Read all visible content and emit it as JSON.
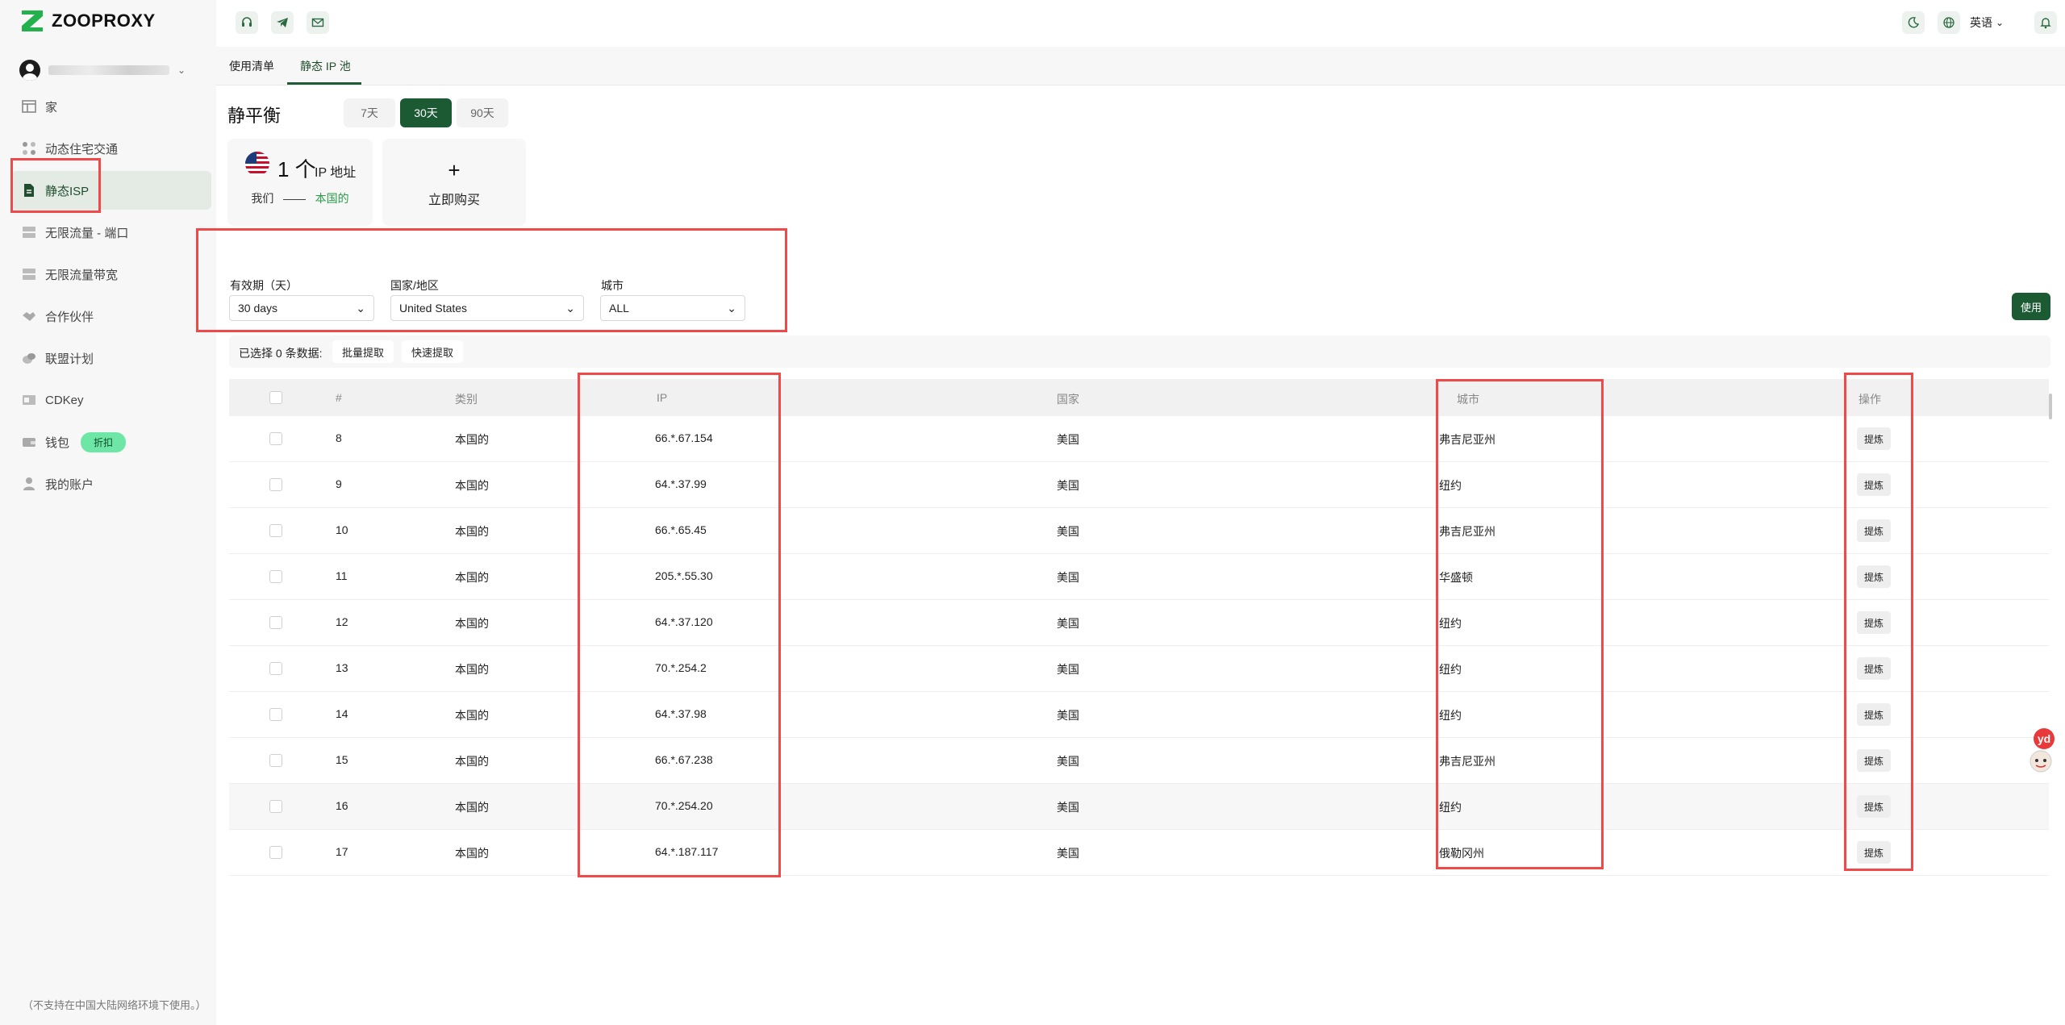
{
  "brand": {
    "name": "ZOOPROXY",
    "accent": "#1c5a34",
    "logo_color": "#22b14c"
  },
  "sidebar": {
    "items": [
      {
        "label": "家",
        "icon": "layout-icon"
      },
      {
        "label": "动态住宅交通",
        "icon": "nodes-icon"
      },
      {
        "label": "静态ISP",
        "icon": "document-icon"
      },
      {
        "label": "无限流量 - 端口",
        "icon": "server-icon"
      },
      {
        "label": "无限流量带宽",
        "icon": "server-icon"
      },
      {
        "label": "合作伙伴",
        "icon": "handshake-icon"
      },
      {
        "label": "联盟计划",
        "icon": "coins-icon"
      },
      {
        "label": "CDKey",
        "icon": "card-icon"
      },
      {
        "label": "钱包",
        "icon": "wallet-icon",
        "badge": "折扣"
      },
      {
        "label": "我的账户",
        "icon": "user-icon"
      }
    ],
    "footer": "（不支持在中国大陆网络环境下使用。）"
  },
  "topbar": {
    "language": "英语"
  },
  "tabs": [
    "使用清单",
    "静态 IP 池"
  ],
  "balance": {
    "title": "静平衡",
    "periods": [
      "7天",
      "30天",
      "90天"
    ],
    "active_period": "30天",
    "count": "1 个",
    "unit": "IP 地址",
    "region": "我们",
    "dash": "——",
    "type": "本国的",
    "buy_plus": "+",
    "buy_label": "立即购买"
  },
  "filters": {
    "validity_label": "有效期（天）",
    "validity_value": "30 days",
    "country_label": "国家/地区",
    "country_value": "United States",
    "city_label": "城市",
    "city_value": "ALL"
  },
  "use_button": "使用",
  "selection": {
    "text": "已选择 0 条数据:",
    "batch": "批量提取",
    "quick": "快速提取"
  },
  "table": {
    "headers": [
      "#",
      "类别",
      "IP",
      "国家",
      "城市",
      "操作"
    ],
    "action_label": "提炼",
    "rows": [
      {
        "num": "8",
        "type": "本国的",
        "ip": "66.*.67.154",
        "country": "美国",
        "city": "弗吉尼亚州"
      },
      {
        "num": "9",
        "type": "本国的",
        "ip": "64.*.37.99",
        "country": "美国",
        "city": "纽约"
      },
      {
        "num": "10",
        "type": "本国的",
        "ip": "66.*.65.45",
        "country": "美国",
        "city": "弗吉尼亚州"
      },
      {
        "num": "11",
        "type": "本国的",
        "ip": "205.*.55.30",
        "country": "美国",
        "city": "华盛顿"
      },
      {
        "num": "12",
        "type": "本国的",
        "ip": "64.*.37.120",
        "country": "美国",
        "city": "纽约"
      },
      {
        "num": "13",
        "type": "本国的",
        "ip": "70.*.254.2",
        "country": "美国",
        "city": "纽约"
      },
      {
        "num": "14",
        "type": "本国的",
        "ip": "64.*.37.98",
        "country": "美国",
        "city": "纽约"
      },
      {
        "num": "15",
        "type": "本国的",
        "ip": "66.*.67.238",
        "country": "美国",
        "city": "弗吉尼亚州"
      },
      {
        "num": "16",
        "type": "本国的",
        "ip": "70.*.254.20",
        "country": "美国",
        "city": "纽约"
      },
      {
        "num": "17",
        "type": "本国的",
        "ip": "64.*.187.117",
        "country": "美国",
        "city": "俄勒冈州"
      }
    ]
  }
}
